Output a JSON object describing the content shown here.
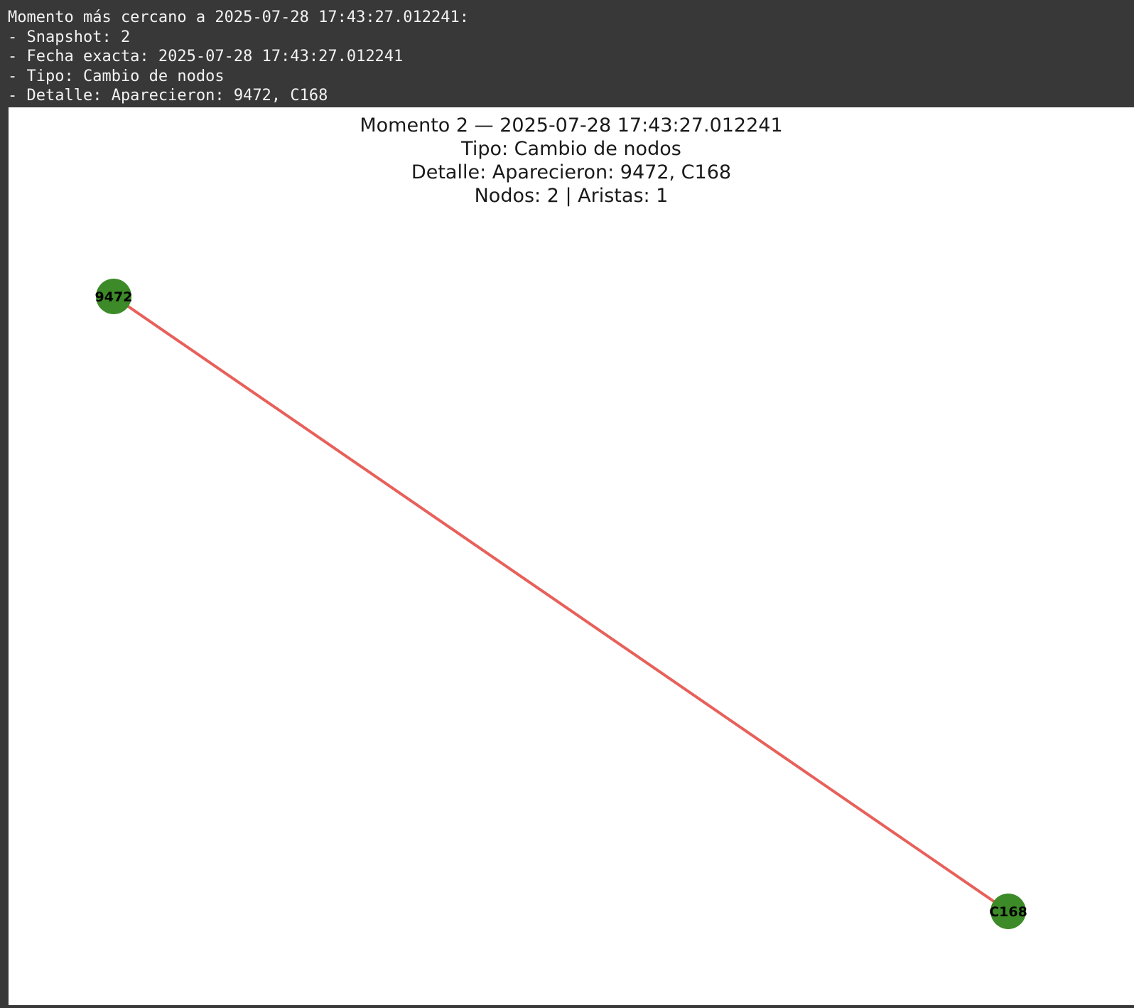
{
  "console": {
    "lines": [
      "Momento más cercano a 2025-07-28 17:43:27.012241:",
      "- Snapshot: 2",
      "- Fecha exacta: 2025-07-28 17:43:27.012241",
      "- Tipo: Cambio de nodos",
      "- Detalle: Aparecieron: 9472, C168"
    ]
  },
  "figure": {
    "title_lines": [
      "Momento 2 — 2025-07-28 17:43:27.012241",
      "Tipo: Cambio de nodos",
      "Detalle: Aparecieron: 9472, C168",
      "Nodos: 2 | Aristas: 1"
    ],
    "colors": {
      "node_fill": "#3c8a28",
      "edge_stroke": "#e8605a",
      "label": "#000000"
    },
    "nodes": [
      {
        "id": "9472",
        "label": "9472"
      },
      {
        "id": "C168",
        "label": "C168"
      }
    ],
    "edges": [
      {
        "source": "9472",
        "target": "C168"
      }
    ]
  }
}
